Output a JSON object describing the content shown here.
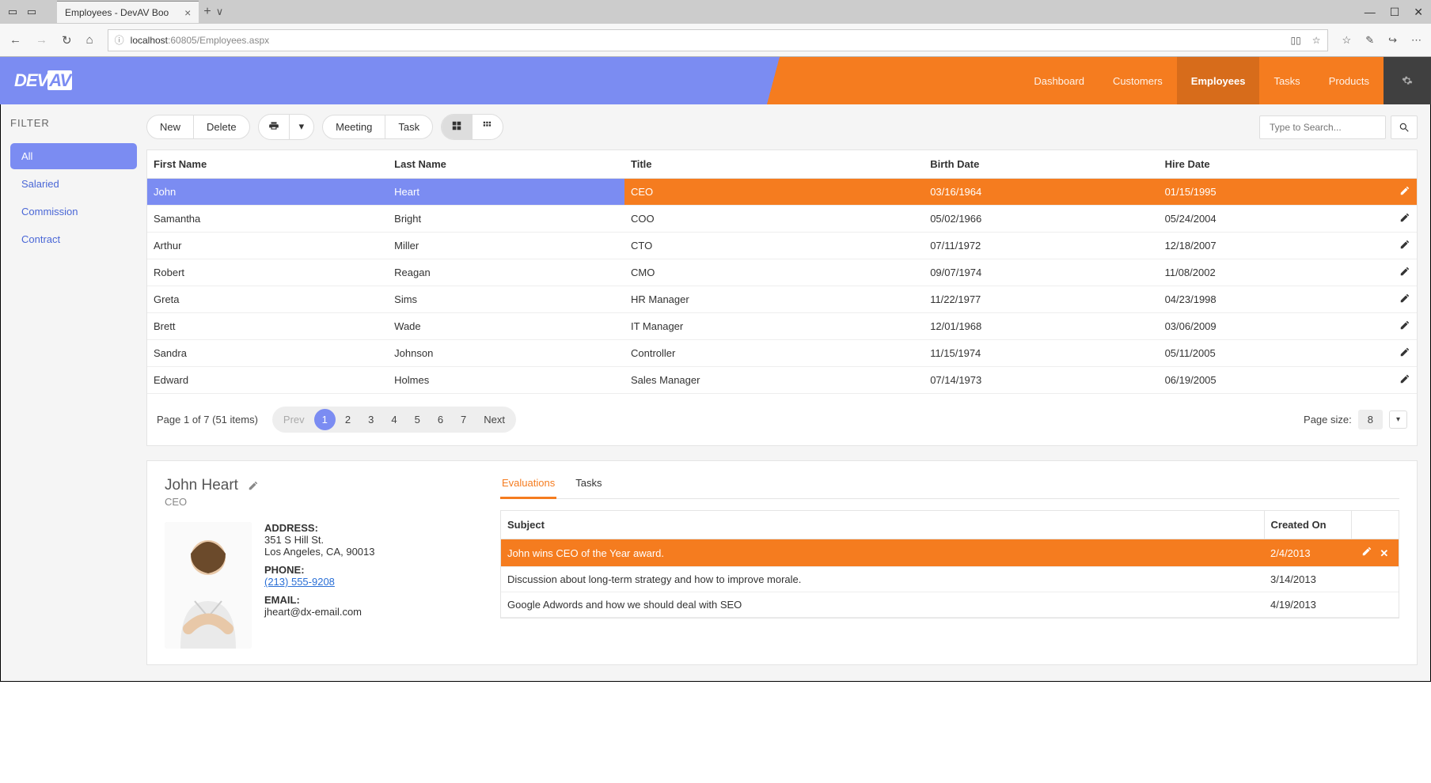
{
  "browser": {
    "tab_title": "Employees - DevAV Boo",
    "url_host": "localhost",
    "url_port_path": ":60805/Employees.aspx"
  },
  "header": {
    "logo_left": "DEV",
    "logo_right": "AV",
    "nav": [
      "Dashboard",
      "Customers",
      "Employees",
      "Tasks",
      "Products"
    ],
    "active_index": 2
  },
  "sidebar": {
    "title": "FILTER",
    "items": [
      "All",
      "Salaried",
      "Commission",
      "Contract"
    ],
    "active_index": 0
  },
  "toolbar": {
    "new": "New",
    "delete": "Delete",
    "meeting": "Meeting",
    "task": "Task",
    "search_placeholder": "Type to Search..."
  },
  "grid": {
    "columns": [
      "First Name",
      "Last Name",
      "Title",
      "Birth Date",
      "Hire Date"
    ],
    "rows": [
      {
        "first": "John",
        "last": "Heart",
        "title": "CEO",
        "birth": "03/16/1964",
        "hire": "01/15/1995",
        "selected": true
      },
      {
        "first": "Samantha",
        "last": "Bright",
        "title": "COO",
        "birth": "05/02/1966",
        "hire": "05/24/2004"
      },
      {
        "first": "Arthur",
        "last": "Miller",
        "title": "CTO",
        "birth": "07/11/1972",
        "hire": "12/18/2007"
      },
      {
        "first": "Robert",
        "last": "Reagan",
        "title": "CMO",
        "birth": "09/07/1974",
        "hire": "11/08/2002"
      },
      {
        "first": "Greta",
        "last": "Sims",
        "title": "HR Manager",
        "birth": "11/22/1977",
        "hire": "04/23/1998"
      },
      {
        "first": "Brett",
        "last": "Wade",
        "title": "IT Manager",
        "birth": "12/01/1968",
        "hire": "03/06/2009"
      },
      {
        "first": "Sandra",
        "last": "Johnson",
        "title": "Controller",
        "birth": "11/15/1974",
        "hire": "05/11/2005"
      },
      {
        "first": "Edward",
        "last": "Holmes",
        "title": "Sales Manager",
        "birth": "07/14/1973",
        "hire": "06/19/2005"
      }
    ]
  },
  "pager": {
    "info": "Page 1 of 7 (51 items)",
    "prev": "Prev",
    "pages": [
      "1",
      "2",
      "3",
      "4",
      "5",
      "6",
      "7"
    ],
    "next": "Next",
    "page_size_label": "Page size:",
    "page_size_value": "8"
  },
  "detail": {
    "name": "John Heart",
    "subtitle": "CEO",
    "address_label": "ADDRESS:",
    "address_line1": "351 S Hill St.",
    "address_line2": "Los Angeles, CA, 90013",
    "phone_label": "PHONE:",
    "phone": "(213) 555-9208",
    "email_label": "EMAIL:",
    "email": "jheart@dx-email.com",
    "tabs": [
      "Evaluations",
      "Tasks"
    ],
    "active_tab": 0,
    "sub_columns": [
      "Subject",
      "Created On"
    ],
    "sub_rows": [
      {
        "subject": "John wins CEO of the Year award.",
        "created": "2/4/2013",
        "selected": true
      },
      {
        "subject": "Discussion about long-term strategy and how to improve morale.",
        "created": "3/14/2013"
      },
      {
        "subject": "Google Adwords and how we should deal with SEO",
        "created": "4/19/2013"
      }
    ]
  }
}
